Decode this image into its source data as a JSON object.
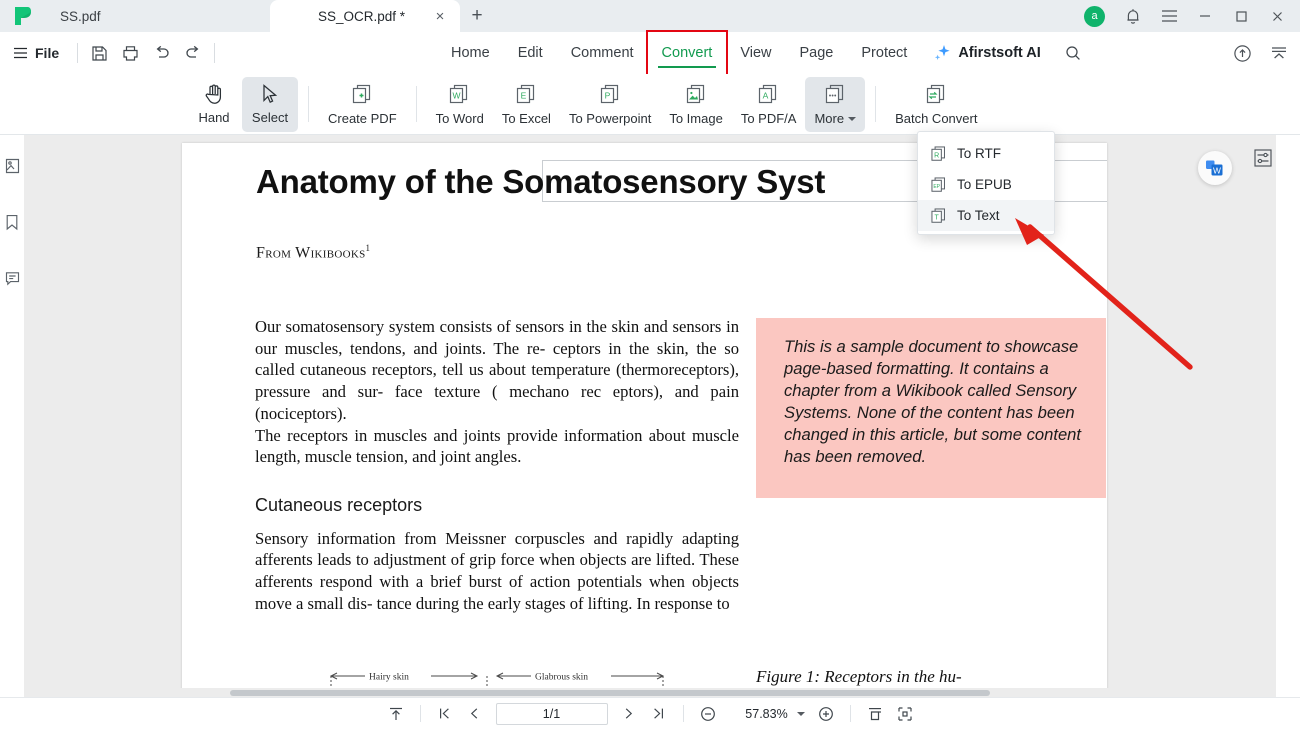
{
  "window": {
    "tabs": [
      {
        "title": "SS.pdf",
        "active": false
      },
      {
        "title": "SS_OCR.pdf *",
        "active": true
      }
    ],
    "new_tab_label": "+",
    "close_label": "×",
    "avatar_initial": "a",
    "controls": {
      "minimize": "—",
      "maximize": "□",
      "close": "✕"
    }
  },
  "menubar": {
    "file_label": "File",
    "quick_actions": [
      "save-icon",
      "print-icon",
      "undo-icon",
      "redo-icon"
    ],
    "tabs": [
      {
        "label": "Home",
        "active": false
      },
      {
        "label": "Edit",
        "active": false
      },
      {
        "label": "Comment",
        "active": false
      },
      {
        "label": "Convert",
        "active": true,
        "highlighted": true
      },
      {
        "label": "View",
        "active": false
      },
      {
        "label": "Page",
        "active": false
      },
      {
        "label": "Protect",
        "active": false
      }
    ],
    "ai_label": "Afirstsoft AI",
    "search_icon": "search-icon",
    "right_icons": [
      "cloud-upload-icon",
      "collapse-ribbon-icon"
    ]
  },
  "ribbon": {
    "items": [
      {
        "label": "Hand",
        "icon": "hand-icon",
        "selected": false
      },
      {
        "label": "Select",
        "icon": "cursor-arrow-icon",
        "selected": true
      },
      {
        "label": "Create PDF",
        "icon": "create-pdf-icon",
        "selected": false
      },
      {
        "label": "To Word",
        "icon": "to-word-icon",
        "selected": false
      },
      {
        "label": "To Excel",
        "icon": "to-excel-icon",
        "selected": false
      },
      {
        "label": "To Powerpoint",
        "icon": "to-powerpoint-icon",
        "selected": false
      },
      {
        "label": "To Image",
        "icon": "to-image-icon",
        "selected": false
      },
      {
        "label": "To PDF/A",
        "icon": "to-pdfa-icon",
        "selected": false
      },
      {
        "label": "More",
        "icon": "more-icon",
        "selected": true,
        "has_caret": true
      },
      {
        "label": "Batch Convert",
        "icon": "batch-convert-icon",
        "selected": false
      }
    ]
  },
  "more_menu": {
    "items": [
      {
        "label": "To RTF",
        "icon": "rtf-file-icon",
        "hovered": false
      },
      {
        "label": "To EPUB",
        "icon": "epub-file-icon",
        "hovered": false
      },
      {
        "label": "To Text",
        "icon": "text-file-icon",
        "hovered": true
      }
    ]
  },
  "left_rail": {
    "items": [
      {
        "name": "thumbnails-icon"
      },
      {
        "name": "bookmarks-icon"
      },
      {
        "name": "comments-icon"
      }
    ]
  },
  "right_rail": {
    "word_badge_icon": "word-convert-badge-icon",
    "properties_icon": "properties-panel-icon"
  },
  "document": {
    "title": "Anatomy of the Somatosensory Syst",
    "source_line": "From Wikibooks",
    "source_sup": "1",
    "paragraph_1": "Our somatosensory system consists of  sensors in the skin  and sensors in our  muscles, tendons, and  joints. The re- ceptors in the skin, the so  called cutaneous receptors,  tell  us about temperature (thermoreceptors),  pressure and sur- face texture (  mechano  rec  eptors),  and  pain  (nociceptors).",
    "paragraph_2": "The receptors in muscles and joints provide  information about muscle length, muscle   tension, and joint angles.",
    "section_heading": "Cutaneous receptors",
    "paragraph_3": "Sensory information from Meissner corpuscles and rapidly adapting afferents leads to adjustment of grip force when objects  are  lifted.  These  afferents  respond  with  a  brief burst of action potentials when objects move a small dis- tance  during  the  early  stages  of  lifting.  In  response  to",
    "callout": "This is a sample document to showcase page-based formatting. It contains a chapter from a Wikibook called Sensory Systems. None of the content has been changed in this article, but some content has been removed.",
    "callout_bg": "#fbc7c1",
    "figure_caption": "Figure 1:  Receptors in the hu-",
    "diagram_labels": [
      "Hairy skin",
      "Glabrous skin"
    ]
  },
  "annotation": {
    "arrow_color": "#e2231a",
    "highlight_color": "#e30613"
  },
  "statusbar": {
    "page_value": "1/1",
    "zoom_value": "57.83%",
    "icons": [
      "scroll-to-top-icon",
      "first-page-icon",
      "previous-page-icon",
      "next-page-icon",
      "last-page-icon",
      "zoom-out-icon",
      "zoom-in-icon",
      "fit-page-icon",
      "fit-width-icon"
    ]
  }
}
